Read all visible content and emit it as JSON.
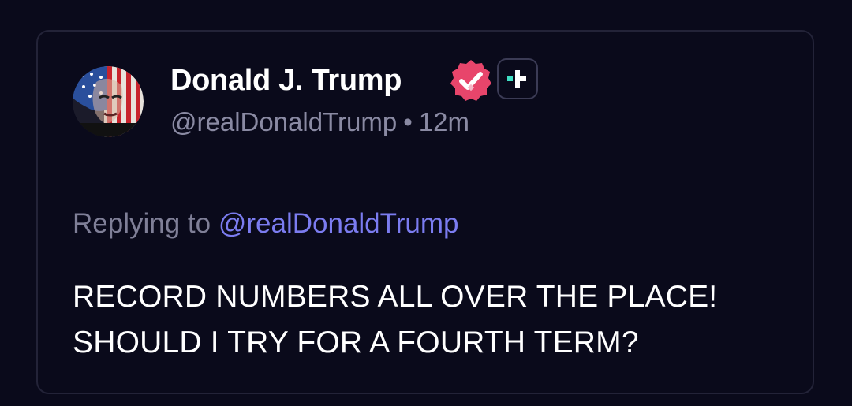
{
  "post": {
    "author": {
      "display_name": "Donald J. Trump",
      "handle": "@realDonaldTrump",
      "verified_badge_color": "#e8456b",
      "avatar_icon": "american-flag-portrait"
    },
    "meta_separator": "•",
    "time_ago": "12m",
    "follow_button_icon": "plus-icon",
    "replying_to_prefix": "Replying to",
    "replying_to_handle": "@realDonaldTrump",
    "text_lines": [
      "RECORD NUMBERS ALL OVER THE PLACE!",
      "SHOULD I TRY FOR A FOURTH TERM?"
    ]
  },
  "colors": {
    "background": "#0a0a1b",
    "mention": "#7b7cf0",
    "muted_text": "#8a8aa3",
    "accent_teal": "#3fe0c5"
  }
}
